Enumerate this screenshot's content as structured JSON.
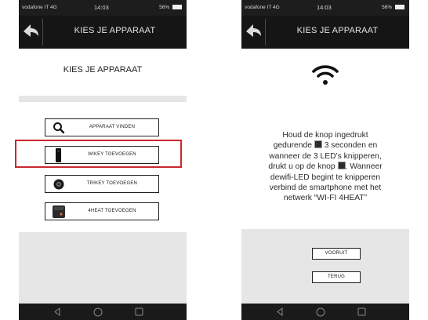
{
  "status": {
    "carrier": "vodafone IT  4G",
    "time": "14:03",
    "battery": "56%"
  },
  "left": {
    "header_title": "KIES JE APPARAAT",
    "panel_title": "KIES JE APPARAAT",
    "options": [
      {
        "label": "APPARAAT VINDEN",
        "icon": "search-icon"
      },
      {
        "label": "WIKEY TOEVOEGEN",
        "icon": "wikey-device-icon"
      },
      {
        "label": "TRIKEY TOEVOEGEN",
        "icon": "trikey-device-icon"
      },
      {
        "label": "4HEAT TOEVOEGEN",
        "icon": "4heat-device-icon"
      }
    ],
    "highlight_color": "#c8282d"
  },
  "right": {
    "header_title": "KIES JE APPARAAT",
    "instruction": {
      "line1": "Houd de knop ingedrukt",
      "line2a": "gedurende",
      "line2b": "3 seconden en",
      "line3": "wanneer de 3 LED’s knipperen,",
      "line4a": "drukt u op de knop",
      "line4b": ". Wanneer",
      "line5": "dewifi-LED begint te knipperen",
      "line6": "verbind de smartphone met het",
      "line7": "netwerk “WI-FI 4HEAT”"
    },
    "buttons": {
      "next": "VOORUIT",
      "back": "TERUG"
    },
    "icon": "wifi-icon"
  }
}
